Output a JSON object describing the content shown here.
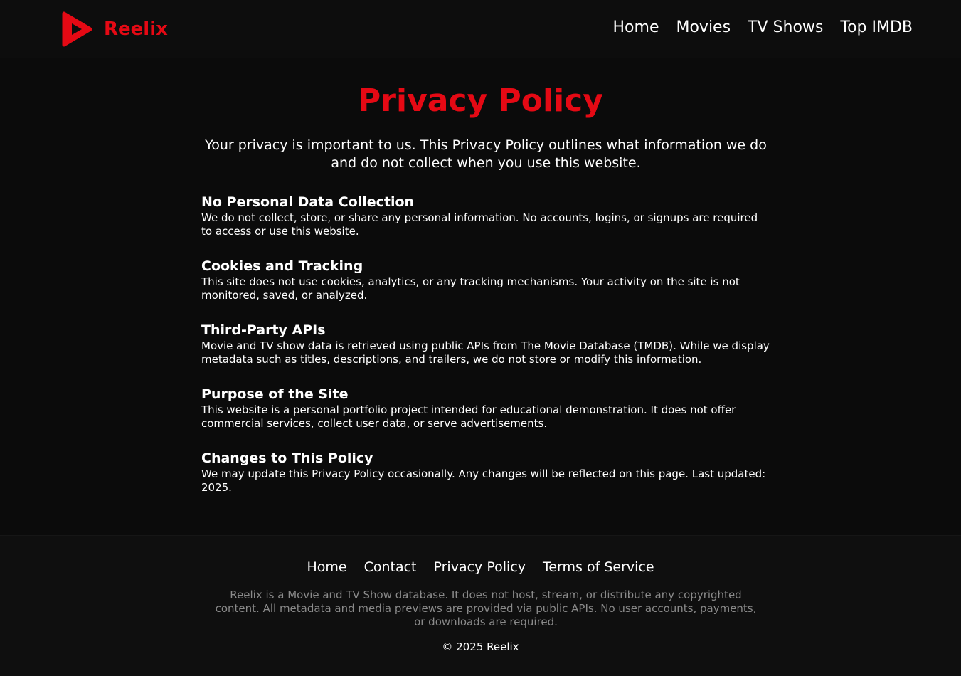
{
  "brand": {
    "name": "Reelix",
    "accent": "#e50914",
    "logo_icon": "play-logo-icon"
  },
  "nav": {
    "items": [
      "Home",
      "Movies",
      "TV Shows",
      "Top IMDB"
    ]
  },
  "page": {
    "title": "Privacy Policy",
    "intro": "Your privacy is important to us. This Privacy Policy outlines what information we do and do not collect when you use this website."
  },
  "sections": [
    {
      "heading": "No Personal Data Collection",
      "body": "We do not collect, store, or share any personal information. No accounts, logins, or signups are required to access or use this website."
    },
    {
      "heading": "Cookies and Tracking",
      "body": "This site does not use cookies, analytics, or any tracking mechanisms. Your activity on the site is not monitored, saved, or analyzed."
    },
    {
      "heading": "Third-Party APIs",
      "body": "Movie and TV show data is retrieved using public APIs from The Movie Database (TMDB). While we display metadata such as titles, descriptions, and trailers, we do not store or modify this information."
    },
    {
      "heading": "Purpose of the Site",
      "body": "This website is a personal portfolio project intended for educational demonstration. It does not offer commercial services, collect user data, or serve advertisements."
    },
    {
      "heading": "Changes to This Policy",
      "body": "We may update this Privacy Policy occasionally. Any changes will be reflected on this page. Last updated: 2025."
    }
  ],
  "footer": {
    "links": [
      "Home",
      "Contact",
      "Privacy Policy",
      "Terms of Service"
    ],
    "description": "Reelix is a Movie and TV Show database. It does not host, stream, or distribute any copyrighted content. All metadata and media previews are provided via public APIs. No user accounts, payments, or downloads are required.",
    "copyright": "© 2025 Reelix"
  }
}
